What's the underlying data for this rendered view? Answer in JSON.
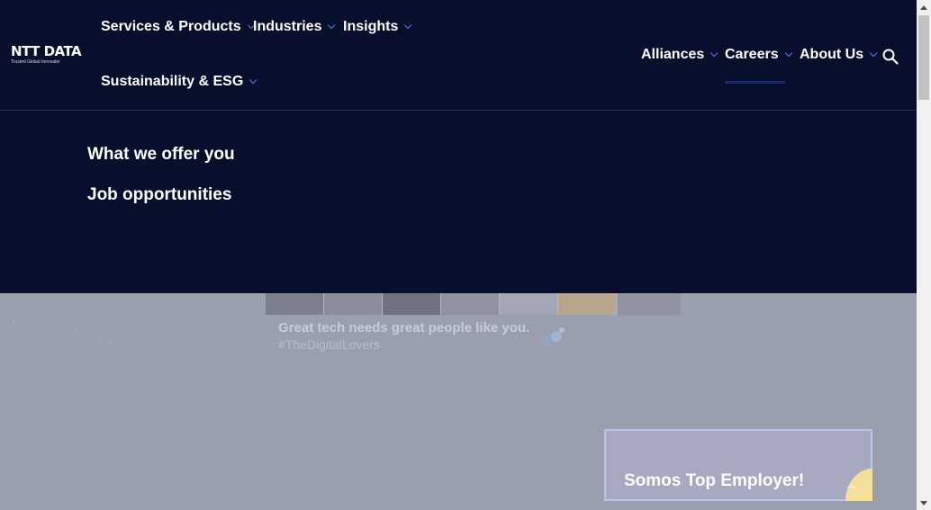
{
  "logo": {
    "name": "NTT DATA",
    "tagline": "Trusted Global Innovator"
  },
  "nav": {
    "services": "Services & Products",
    "industries": "Industries",
    "insights": "Insights",
    "sustainability": "Sustainability & ESG",
    "alliances": "Alliances",
    "careers": "Careers",
    "about": "About Us"
  },
  "dropdown": {
    "items": [
      "What we offer you",
      "Job opportunities"
    ]
  },
  "hero": {
    "title": "Great tech needs great people like you.",
    "tag": "#TheDigitalLovers"
  },
  "card": {
    "label": "Somos Top Employer!"
  },
  "colors": {
    "header_bg": "#070f2d",
    "accent": "#4f7cf6",
    "card_deco": "#f4df9a"
  },
  "icons": {
    "search": "search-icon",
    "chevron": "chevron-down-icon",
    "arrow": "arrow-right-icon"
  }
}
